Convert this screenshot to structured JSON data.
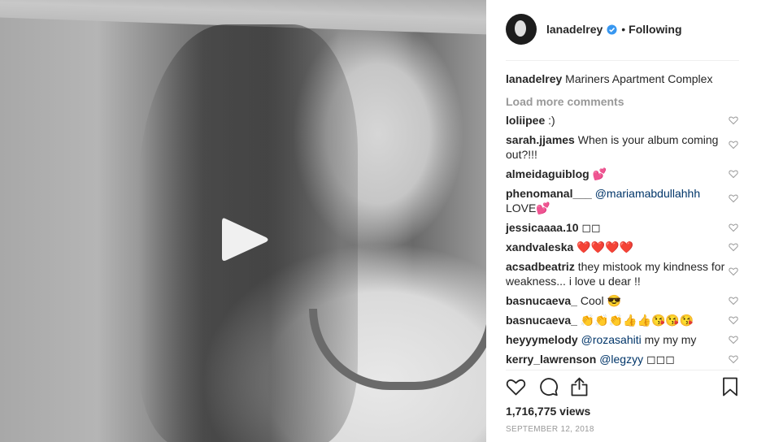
{
  "post": {
    "username": "lanadelrey",
    "separator": "•",
    "follow_state": "Following",
    "caption_user": "lanadelrey",
    "caption_text": "Mariners Apartment Complex",
    "load_more": "Load more comments",
    "views": "1,716,775 views",
    "date": "SEPTEMBER 12, 2018"
  },
  "comments": [
    {
      "user": "loliipee",
      "text": ":)"
    },
    {
      "user": "sarah.jjames",
      "text": "When is your album coming out?!!!"
    },
    {
      "user": "almeidaguiblog",
      "text": "💕"
    },
    {
      "user": "phenomanal___",
      "mention": "@mariamabdullahhh",
      "text": "LOVE💕"
    },
    {
      "user": "jessicaaaa.10",
      "text": "◻◻"
    },
    {
      "user": "xandvaleska",
      "text": "❤️❤️❤️❤️"
    },
    {
      "user": "acsadbeatriz",
      "text": "they mistook my kindness for weakness... i love u dear !!"
    },
    {
      "user": "basnucaeva_",
      "text": "Cool 😎"
    },
    {
      "user": "basnucaeva_",
      "text": "👏👏👏👍👍😘😘😘"
    },
    {
      "user": "heyyymelody",
      "mention": "@rozasahiti",
      "text": "my my my"
    },
    {
      "user": "kerry_lawrenson",
      "mention": "@legzyy",
      "text": "◻◻◻"
    }
  ],
  "icons": {
    "play": "play-icon",
    "verified": "verified-badge-icon",
    "like": "heart-icon",
    "comment": "comment-icon",
    "share": "share-icon",
    "save": "bookmark-icon"
  },
  "colors": {
    "verified": "#3897f0",
    "mention": "#003569",
    "muted": "#999999"
  }
}
